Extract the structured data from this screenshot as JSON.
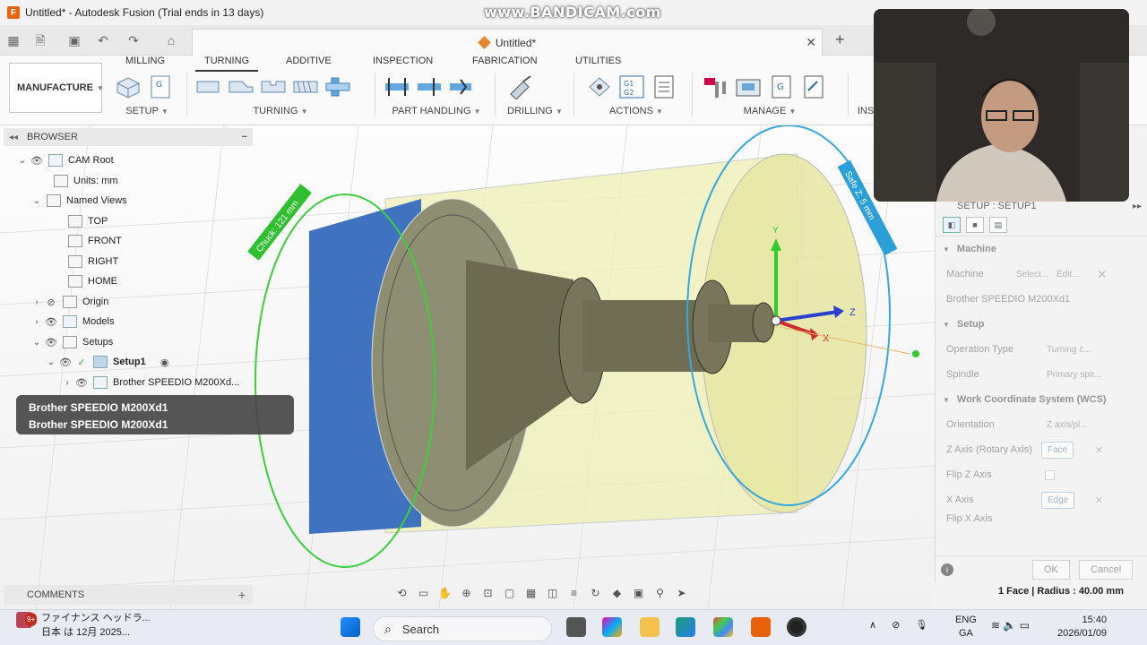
{
  "window": {
    "app_icon": "F",
    "title": "Untitled* - Autodesk Fusion (Trial ends in 13 days)",
    "watermark": "www.BANDICAM.com"
  },
  "document_tab": {
    "label": "Untitled*"
  },
  "ribbon": {
    "workspace": "MANUFACTURE",
    "tabs": [
      "MILLING",
      "TURNING",
      "ADDITIVE",
      "INSPECTION",
      "FABRICATION",
      "UTILITIES"
    ],
    "active_tab": "TURNING",
    "groups": [
      "SETUP",
      "TURNING",
      "PART HANDLING",
      "DRILLING",
      "ACTIONS",
      "MANAGE",
      "INS"
    ]
  },
  "browser": {
    "header": "BROWSER",
    "items": [
      {
        "label": "CAM Root"
      },
      {
        "label": "Units: mm"
      },
      {
        "label": "Named Views"
      },
      {
        "label": "TOP"
      },
      {
        "label": "FRONT"
      },
      {
        "label": "RIGHT"
      },
      {
        "label": "HOME"
      },
      {
        "label": "Origin"
      },
      {
        "label": "Models"
      },
      {
        "label": "Setups"
      },
      {
        "label": "Setup1"
      },
      {
        "label": "Brother SPEEDIO M200Xd..."
      }
    ]
  },
  "tooltip": {
    "lines": [
      "Brother SPEEDIO M200Xd1",
      "Brother SPEEDIO M200Xd1"
    ]
  },
  "viewport": {
    "chuck_label": "Chuck: 121 mm",
    "safe_label": "Safe Z: 5 mm",
    "axis_y": "Y",
    "axis_z": "Z",
    "axis_x": "X"
  },
  "comments": {
    "label": "COMMENTS"
  },
  "setup_panel": {
    "title": "SETUP : SETUP1",
    "machine_section": "Machine",
    "machine_label": "Machine",
    "select_label": "Select...",
    "edit_label": "Edit...",
    "machine_name": "Brother SPEEDIO M200Xd1",
    "setup_section": "Setup",
    "operation_type_label": "Operation Type",
    "operation_type_value": "Turning c...",
    "spindle_label": "Spindle",
    "spindle_value": "Primary spir...",
    "wcs_section": "Work Coordinate System (WCS)",
    "orientation_label": "Orientation",
    "orientation_value": "Z axis/pl...",
    "z_axis_label": "Z Axis (Rotary Axis)",
    "z_axis_value": "Face",
    "flip_z_label": "Flip Z Axis",
    "x_axis_label": "X Axis",
    "x_axis_value": "Edge",
    "flip_x_label": "Flip X Axis",
    "ok_label": "OK",
    "cancel_label": "Cancel"
  },
  "status": {
    "measure": "1 Face | Radius : 40.00 mm"
  },
  "taskbar": {
    "weather_badge": "9+",
    "weather_line1": "ファイナンス ヘッドラ...",
    "weather_line2": "日本 は 12月 2025...",
    "search_placeholder": "Search",
    "lang_line1": "ENG",
    "lang_line2": "GA",
    "time": "15:40",
    "date": "2026/01/09"
  },
  "colors": {
    "accent": "#e8620c",
    "stock_yellow": "#eef0b4",
    "chuck_blue": "#3f73c0",
    "chuck_ring_green": "#3ccf3c",
    "safe_ring_blue": "#35a8e0"
  }
}
